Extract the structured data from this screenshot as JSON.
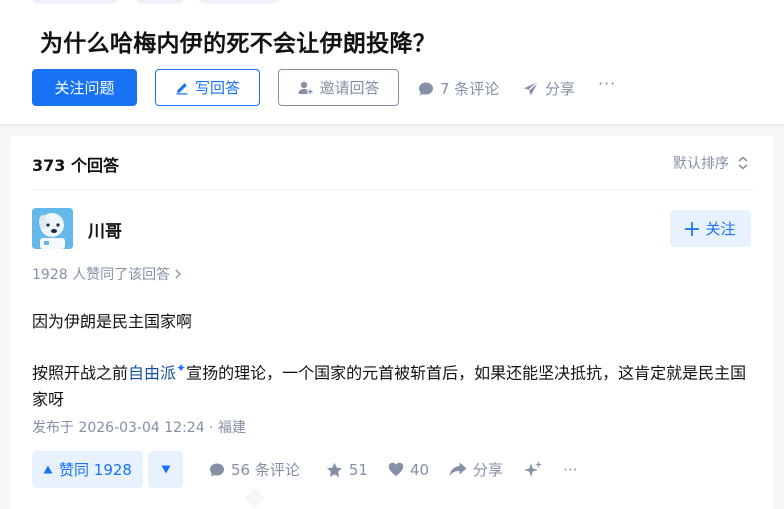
{
  "question": {
    "title": "为什么哈梅内伊的死不会让伊朗投降？",
    "follow_label": "关注问题",
    "write_label": "写回答",
    "invite_label": "邀请回答",
    "comments_label": "7 条评论",
    "share_label": "分享",
    "more_label": "···"
  },
  "answers_header": {
    "count_label": "373 个回答",
    "sort_label": "默认排序"
  },
  "answer": {
    "author_name": "川哥",
    "follow_label": "关注",
    "voters_label": "1928 人赞同了该回答",
    "paragraph1": "因为伊朗是民主国家啊",
    "paragraph2_before": "按照开战之前",
    "paragraph2_link": "自由派",
    "paragraph2_after": "宣扬的理论，一个国家的元首被斩首后，如果还能坚决抵抗，这肯定就是民主国家呀",
    "published": "发布于 2026-03-04 12:24 · 福建",
    "upvote_label": "赞同 1928",
    "comments_label": "56 条评论",
    "favorites": "51",
    "likes": "40",
    "share_label": "分享",
    "more_label": "···"
  },
  "colors": {
    "brand_blue": "#1772f6",
    "muted_gray": "#8590a6",
    "light_blue_bg": "#e8f2fe",
    "link_blue": "#175199"
  },
  "icons": [
    "pen-icon",
    "add-person-icon",
    "comment-bubble-icon",
    "paper-plane-icon",
    "sort-updown-icon",
    "plus-icon",
    "chevron-right-icon",
    "triangle-up-icon",
    "triangle-down-icon",
    "star-icon",
    "heart-icon",
    "share-arrow-icon",
    "sparkle-icon",
    "avatar-dog"
  ]
}
